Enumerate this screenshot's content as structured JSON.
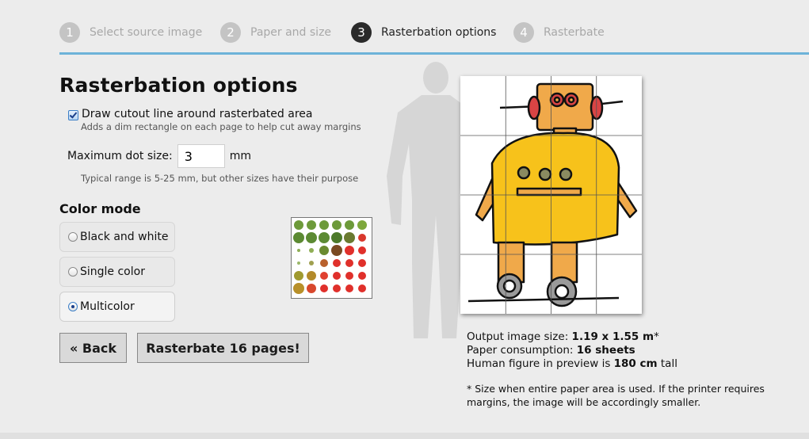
{
  "steps": [
    {
      "num": "1",
      "label": "Select source image"
    },
    {
      "num": "2",
      "label": "Paper and size"
    },
    {
      "num": "3",
      "label": "Rasterbation options"
    },
    {
      "num": "4",
      "label": "Rasterbate"
    }
  ],
  "active_step": 3,
  "page_title": "Rasterbation options",
  "cutout": {
    "checked": true,
    "label": "Draw cutout line around rasterbated area",
    "hint": "Adds a dim rectangle on each page to help cut away margins"
  },
  "dot_size": {
    "label": "Maximum dot size:",
    "value": "3",
    "unit": "mm",
    "hint": "Typical range is 5-25 mm, but other sizes have their purpose"
  },
  "color_mode": {
    "title": "Color mode",
    "options": [
      "Black and white",
      "Single color",
      "Multicolor"
    ],
    "selected": "Multicolor"
  },
  "buttons": {
    "back": "« Back",
    "rasterbate": "Rasterbate 16 pages!"
  },
  "info": {
    "output_label": "Output image size: ",
    "output_value": "1.19 x 1.55 m",
    "output_suffix": "*",
    "paper_label": "Paper consumption: ",
    "paper_value": "16 sheets",
    "human_label": "Human figure in preview is ",
    "human_value": "180 cm",
    "human_suffix": " tall",
    "note": "* Size when entire paper area is used. If the printer requires margins, the image will be accordingly smaller."
  },
  "colors": {
    "accent": "#6db3d9",
    "robot_yellow": "#f7c21b",
    "robot_orange": "#f0a94a",
    "robot_red": "#d94444"
  }
}
